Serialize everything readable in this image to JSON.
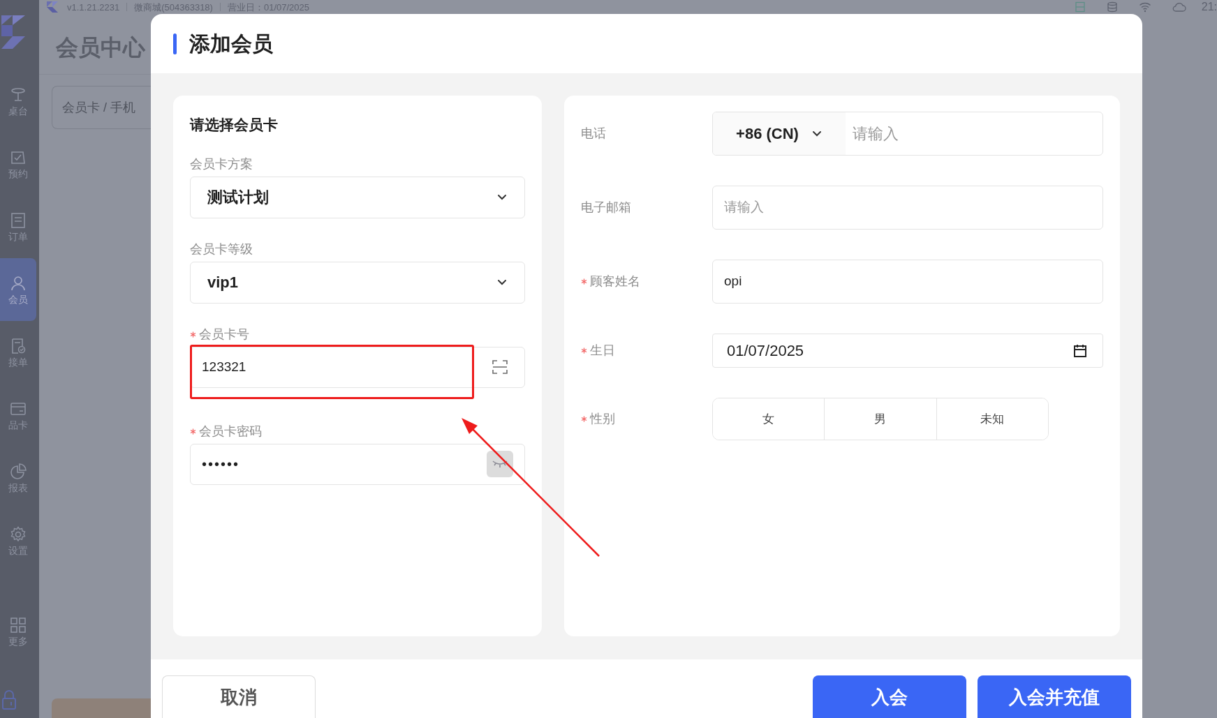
{
  "top_bar": {
    "version": "v1.1.21.2231",
    "store": "微商城(504363318)",
    "business_day": "营业日：01/07/2025",
    "time": "21:"
  },
  "sidebar": {
    "items": [
      {
        "label": "桌台",
        "selected": false
      },
      {
        "label": "预约",
        "selected": false
      },
      {
        "label": "订单",
        "selected": false
      },
      {
        "label": "会员",
        "selected": true
      },
      {
        "label": "接单",
        "selected": false
      },
      {
        "label": "品卡",
        "selected": false
      },
      {
        "label": "报表",
        "selected": false
      },
      {
        "label": "设置",
        "selected": false
      },
      {
        "label": "更多",
        "selected": false
      }
    ]
  },
  "page": {
    "title": "会员中心",
    "search": {
      "placeholder": "会员卡 / 手机"
    }
  },
  "dialog": {
    "title": "添加会员",
    "card_section": {
      "heading": "请选择会员卡",
      "fields": [
        {
          "kind": "select",
          "label": "会员卡方案",
          "required": false,
          "value": "测试计划"
        },
        {
          "kind": "select",
          "label": "会员卡等级",
          "required": false,
          "value": "vip1"
        },
        {
          "kind": "scan",
          "label": "会员卡号",
          "required": true,
          "value": "123321",
          "highlighted": true
        },
        {
          "kind": "password",
          "label": "会员卡密码",
          "required": true,
          "value": "••••••"
        }
      ]
    },
    "customer_section": {
      "fields": [
        {
          "kind": "phone",
          "label": "电话",
          "required": false,
          "country_code": "+86 (CN)",
          "placeholder": "请输入"
        },
        {
          "kind": "text",
          "label": "电子邮箱",
          "required": false,
          "placeholder": "请输入"
        },
        {
          "kind": "text",
          "label": "顾客姓名",
          "required": true,
          "value": "opi"
        },
        {
          "kind": "date",
          "label": "生日",
          "required": true,
          "value": "01/07/2025"
        },
        {
          "kind": "segmented",
          "label": "性别",
          "required": true,
          "options": [
            {
              "label": "女",
              "selected": false
            },
            {
              "label": "男",
              "selected": false
            },
            {
              "label": "未知",
              "selected": false
            }
          ]
        }
      ]
    },
    "buttons": [
      {
        "label": "取消",
        "kind": "secondary"
      },
      {
        "label": "入会",
        "kind": "primary"
      },
      {
        "label": "入会并充值",
        "kind": "primary"
      }
    ]
  }
}
